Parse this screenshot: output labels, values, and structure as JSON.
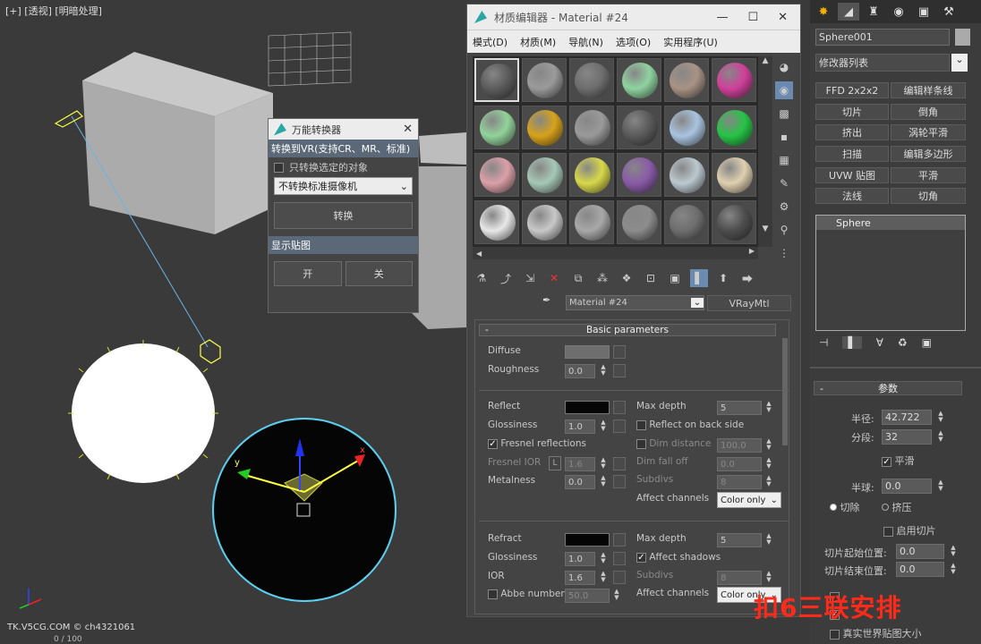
{
  "viewport": {
    "label": "[+] [透视] [明暗处理]",
    "watermark": "TK.V5CG.COM © ch4321061",
    "frame_counter": "0 / 100",
    "gizmo_axes": [
      "x",
      "y",
      "z"
    ]
  },
  "converter": {
    "title": "万能转换器",
    "convert_bar": "转换到VR(支持CR、MR、标准)",
    "only_selected_label": "只转换选定的对象",
    "only_selected_checked": false,
    "camera_select_value": "不转换标准摄像机",
    "convert_button": "转换",
    "show_maps_bar": "显示贴图",
    "on_button": "开",
    "off_button": "关"
  },
  "material_editor": {
    "title": "材质编辑器 - Material #24",
    "menu": [
      "模式(D)",
      "材质(M)",
      "导航(N)",
      "选项(O)",
      "实用程序(U)"
    ],
    "slot_colors": [
      [
        "#5a5a5a",
        "#9a9a9a",
        "#6e6e6e",
        "#8fd3a0",
        "#a89284",
        "#d0409a"
      ],
      [
        "#93d39a",
        "#d7a21a",
        "#9a9a9a",
        "#5a5a5a",
        "#a9c4e0",
        "#26c446"
      ],
      [
        "#dca0a8",
        "#a6c8b6",
        "#d8d84a",
        "#8a5aa8",
        "#bcc8d0",
        "#e0d0b0"
      ],
      [
        "#e8e8e8",
        "#c8c8c8",
        "#a8a8a8",
        "#8c8c8c",
        "#6e6e6e",
        "#4e4e4e"
      ]
    ],
    "material_name": "Material #24",
    "material_type": "VRayMtl",
    "rollout_title": "Basic parameters",
    "diffuse": {
      "label": "Diffuse",
      "roughness_label": "Roughness",
      "roughness": "0.0",
      "color": "#6e6e6e"
    },
    "reflect": {
      "label": "Reflect",
      "color": "#050505",
      "glossiness_label": "Glossiness",
      "glossiness": "1.0",
      "fresnel_label": "Fresnel reflections",
      "fresnel_checked": true,
      "fresnel_ior_label": "Fresnel IOR",
      "fresnel_lock": "L",
      "fresnel_ior": "1.6",
      "metalness_label": "Metalness",
      "metalness": "0.0",
      "max_depth_label": "Max depth",
      "max_depth": "5",
      "backside_label": "Reflect on back side",
      "backside_checked": false,
      "dim_distance_label": "Dim distance",
      "dim_distance_checked": false,
      "dim_distance": "100.0",
      "dim_falloff_label": "Dim fall off",
      "dim_falloff": "0.0",
      "subdivs_label": "Subdivs",
      "subdivs": "8",
      "affect_label": "Affect channels",
      "affect_value": "Color only"
    },
    "refract": {
      "label": "Refract",
      "color": "#050505",
      "glossiness_label": "Glossiness",
      "glossiness": "1.0",
      "ior_label": "IOR",
      "ior": "1.6",
      "abbe_label": "Abbe number",
      "abbe_checked": false,
      "abbe": "50.0",
      "max_depth_label": "Max depth",
      "max_depth": "5",
      "shadows_label": "Affect shadows",
      "shadows_checked": true,
      "subdivs_label": "Subdivs",
      "subdivs": "8",
      "affect_label": "Affect channels",
      "affect_value": "Color only"
    }
  },
  "command_panel": {
    "object_name": "Sphere001",
    "modifier_list": "修改器列表",
    "buttons": [
      "FFD 2x2x2",
      "编辑样条线",
      "切片",
      "倒角",
      "挤出",
      "涡轮平滑",
      "扫描",
      "编辑多边形",
      "UVW 贴图",
      "平滑",
      "法线",
      "切角"
    ],
    "stack_item": "Sphere",
    "params_title": "参数",
    "radius_label": "半径:",
    "radius": "42.722",
    "segments_label": "分段:",
    "segments": "32",
    "smooth_label": "平滑",
    "smooth_checked": true,
    "hemisphere_label": "半球:",
    "hemisphere": "0.0",
    "chop_label": "切除",
    "squash_label": "挤压",
    "slice_label": "启用切片",
    "slice_from_label": "切片起始位置:",
    "slice_from": "0.0",
    "slice_to_label": "切片结束位置:",
    "slice_to": "0.0",
    "real_world_label": "真实世界贴图大小"
  },
  "overlay_text": "扣6三联安排"
}
